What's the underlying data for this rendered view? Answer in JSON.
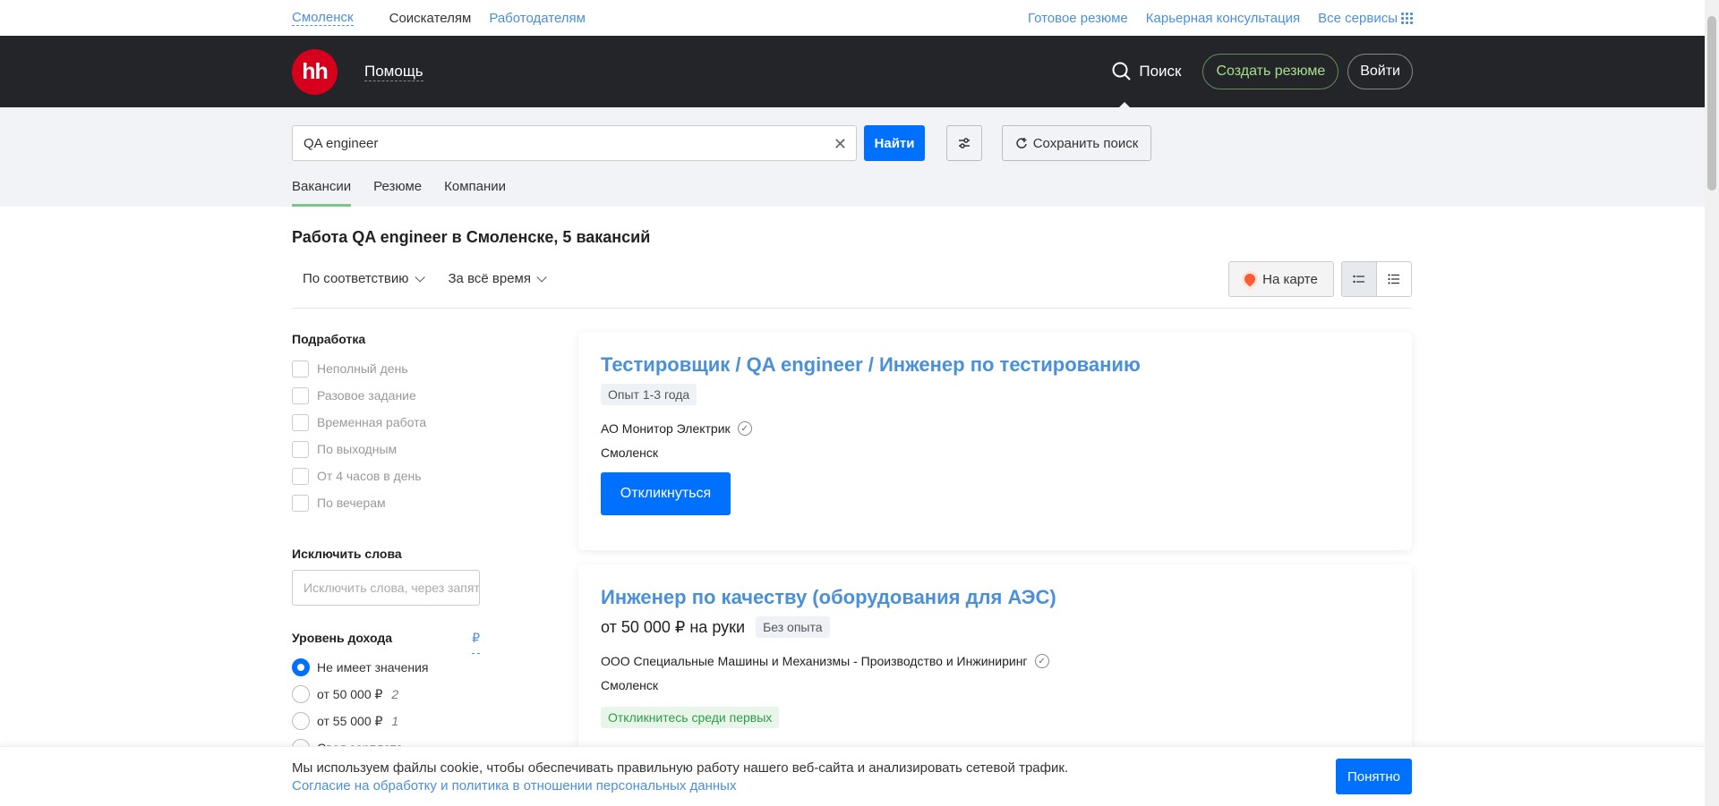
{
  "topbar": {
    "city": "Смоленск",
    "seekers": "Соискателям",
    "employers": "Работодателям",
    "links": [
      "Готовое резюме",
      "Карьерная консультация",
      "Все сервисы"
    ]
  },
  "header": {
    "logo": "hh",
    "help": "Помощь",
    "search": "Поиск",
    "create_resume": "Создать резюме",
    "login": "Войти"
  },
  "search": {
    "query": "QA engineer",
    "find_label": "Найти",
    "save_label": "Сохранить поиск",
    "tabs": [
      "Вакансии",
      "Резюме",
      "Компании"
    ]
  },
  "results": {
    "title": "Работа QA engineer в Смоленске, 5 вакансий",
    "sort": "По соответствию",
    "period": "За всё время",
    "map_label": "На карте"
  },
  "sidebar": {
    "part_time_title": "Подработка",
    "part_time_options": [
      "Неполный день",
      "Разовое задание",
      "Временная работа",
      "По выходным",
      "От 4 часов в день",
      "По вечерам"
    ],
    "exclude_title": "Исключить слова",
    "exclude_placeholder": "Исключить слова, через запятую",
    "income_title": "Уровень дохода",
    "currency": "₽",
    "income_options": [
      {
        "label": "Не имеет значения",
        "count": ""
      },
      {
        "label": "от 50 000 ₽",
        "count": "2"
      },
      {
        "label": "от 55 000 ₽",
        "count": "1"
      },
      {
        "label": "Своя зарплата",
        "count": ""
      }
    ]
  },
  "vacancies": [
    {
      "title": "Тестировщик / QA engineer / Инженер по тестированию",
      "experience": "Опыт 1-3 года",
      "company": "АО Монитор Электрик",
      "city": "Смоленск",
      "respond": "Откликнуться"
    },
    {
      "title": "Инженер по качеству (оборудования для АЭС)",
      "salary": "от 50 000 ₽ на руки",
      "experience": "Без опыта",
      "company": "ООО Специальные Машины и Механизмы - Производство и Инжиниринг",
      "city": "Смоленск",
      "badge": "Откликнитесь среди первых"
    }
  ],
  "cookie": {
    "text": "Мы используем файлы cookie, чтобы обеспечивать правильную работу нашего веб-сайта и анализировать сетевой трафик.",
    "link": "Согласие на обработку и политика в отношении персональных данных",
    "ok": "Понятно"
  },
  "colors": {
    "brand_red": "#d6001c",
    "accent_blue": "#0070ff",
    "link_blue": "#4a90d9",
    "header_dark": "#232529",
    "tab_green": "#7cc589"
  }
}
